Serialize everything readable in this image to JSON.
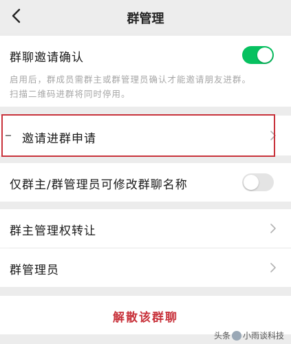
{
  "nav": {
    "title": "群管理"
  },
  "invite_confirm": {
    "label": "群聊邀请确认",
    "enabled": true,
    "description_line1": "启用后，群成员需群主或群管理员确认才能邀请朋友进群。",
    "description_line2": "扫描二维码进群将同时停用。"
  },
  "invite_requests": {
    "label": "邀请进群申请"
  },
  "rename_restriction": {
    "label": "仅群主/群管理员可修改群聊名称",
    "enabled": false
  },
  "owner_transfer": {
    "label": "群主管理权转让"
  },
  "admins": {
    "label": "群管理员"
  },
  "disband": {
    "label": "解散该群聊"
  },
  "watermark": {
    "text_before": "头条",
    "text_after": "小雨谈科技"
  },
  "colors": {
    "toggle_on": "#07c160",
    "toggle_off": "#e4e4e4",
    "danger": "#c8323b",
    "highlight_border": "#c8323b"
  },
  "icons": {
    "back": "chevron-left-icon",
    "row_arrow": "chevron-right-icon"
  }
}
